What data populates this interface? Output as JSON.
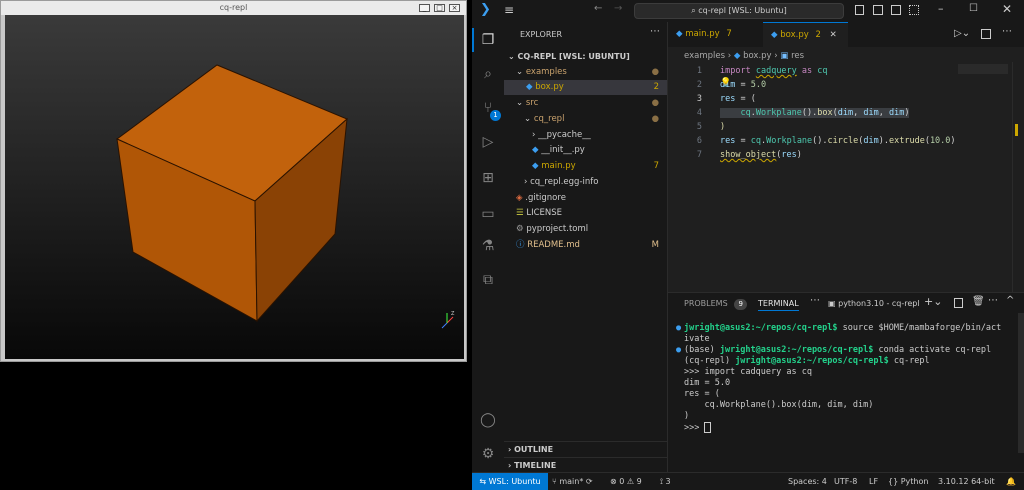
{
  "viewer": {
    "title": "cq-repl"
  },
  "vscode": {
    "command_center": "cq-repl [WSL: Ubuntu]",
    "explorer_header": "EXPLORER",
    "root_folder": "CQ-REPL [WSL: UBUNTU]",
    "tree": [
      {
        "label": "examples",
        "badge": ""
      },
      {
        "label": "box.py",
        "badge": "2"
      },
      {
        "label": "src",
        "badge": ""
      },
      {
        "label": "cq_repl",
        "badge": ""
      },
      {
        "label": "__pycache__",
        "badge": ""
      },
      {
        "label": "__init__.py",
        "badge": ""
      },
      {
        "label": "main.py",
        "badge": "7"
      },
      {
        "label": "cq_repl.egg-info",
        "badge": ""
      },
      {
        "label": ".gitignore",
        "badge": ""
      },
      {
        "label": "LICENSE",
        "badge": ""
      },
      {
        "label": "pyproject.toml",
        "badge": ""
      },
      {
        "label": "README.md",
        "badge": "M"
      }
    ],
    "outline": "OUTLINE",
    "timeline": "TIMELINE",
    "tabs": [
      {
        "label": "main.py",
        "badge": "7"
      },
      {
        "label": "box.py",
        "badge": "2"
      }
    ],
    "breadcrumb": {
      "folder": "examples",
      "file": "box.py",
      "symbol": "res"
    },
    "code_lines": [
      {
        "num": "1",
        "text": "import cadquery as cq"
      },
      {
        "num": "2",
        "text": "dim = 5.0"
      },
      {
        "num": "3",
        "text": "res = ("
      },
      {
        "num": "4",
        "text": "    cq.Workplane().box(dim, dim, dim)"
      },
      {
        "num": "5",
        "text": ")"
      },
      {
        "num": "6",
        "text": "res = cq.Workplane().circle(dim).extrude(10.0)"
      },
      {
        "num": "7",
        "text": "show_object(res)"
      }
    ],
    "panel": {
      "problems": "PROBLEMS",
      "problems_count": "9",
      "terminal": "TERMINAL",
      "terminal_name": "python3.10 - cq-repl"
    },
    "terminal_lines": [
      {
        "prompt": "jwright@asus2:~/repos/cq-repl$",
        "text": " source $HOME/mambaforge/bin/act"
      },
      {
        "prompt": "",
        "text": "ivate"
      },
      {
        "prefix": "(base) ",
        "prompt": "jwright@asus2:~/repos/cq-repl$",
        "text": " conda activate cq-repl"
      },
      {
        "prefix": "(cq-repl) ",
        "prompt": "jwright@asus2:~/repos/cq-repl$",
        "text": " cq-repl"
      },
      {
        "prompt": "",
        "text": ">>> import cadquery as cq"
      },
      {
        "prompt": "",
        "text": "dim = 5.0"
      },
      {
        "prompt": "",
        "text": "res = ("
      },
      {
        "prompt": "",
        "text": "    cq.Workplane().box(dim, dim, dim)"
      },
      {
        "prompt": "",
        "text": ")"
      },
      {
        "prompt": "",
        "text": ">>> "
      }
    ],
    "status": {
      "remote": "WSL: Ubuntu",
      "branch": "main*",
      "errors": "0",
      "warnings": "9",
      "ports": "3",
      "spaces": "Spaces: 4",
      "encoding": "UTF-8",
      "eol": "LF",
      "language": "Python",
      "interpreter": "3.10.12 64-bit"
    },
    "scm_badge": "1"
  },
  "colors": {
    "accent": "#0078d4",
    "cube_front": "#b35708",
    "cube_top": "#c0600a",
    "cube_side": "#8c4306"
  }
}
